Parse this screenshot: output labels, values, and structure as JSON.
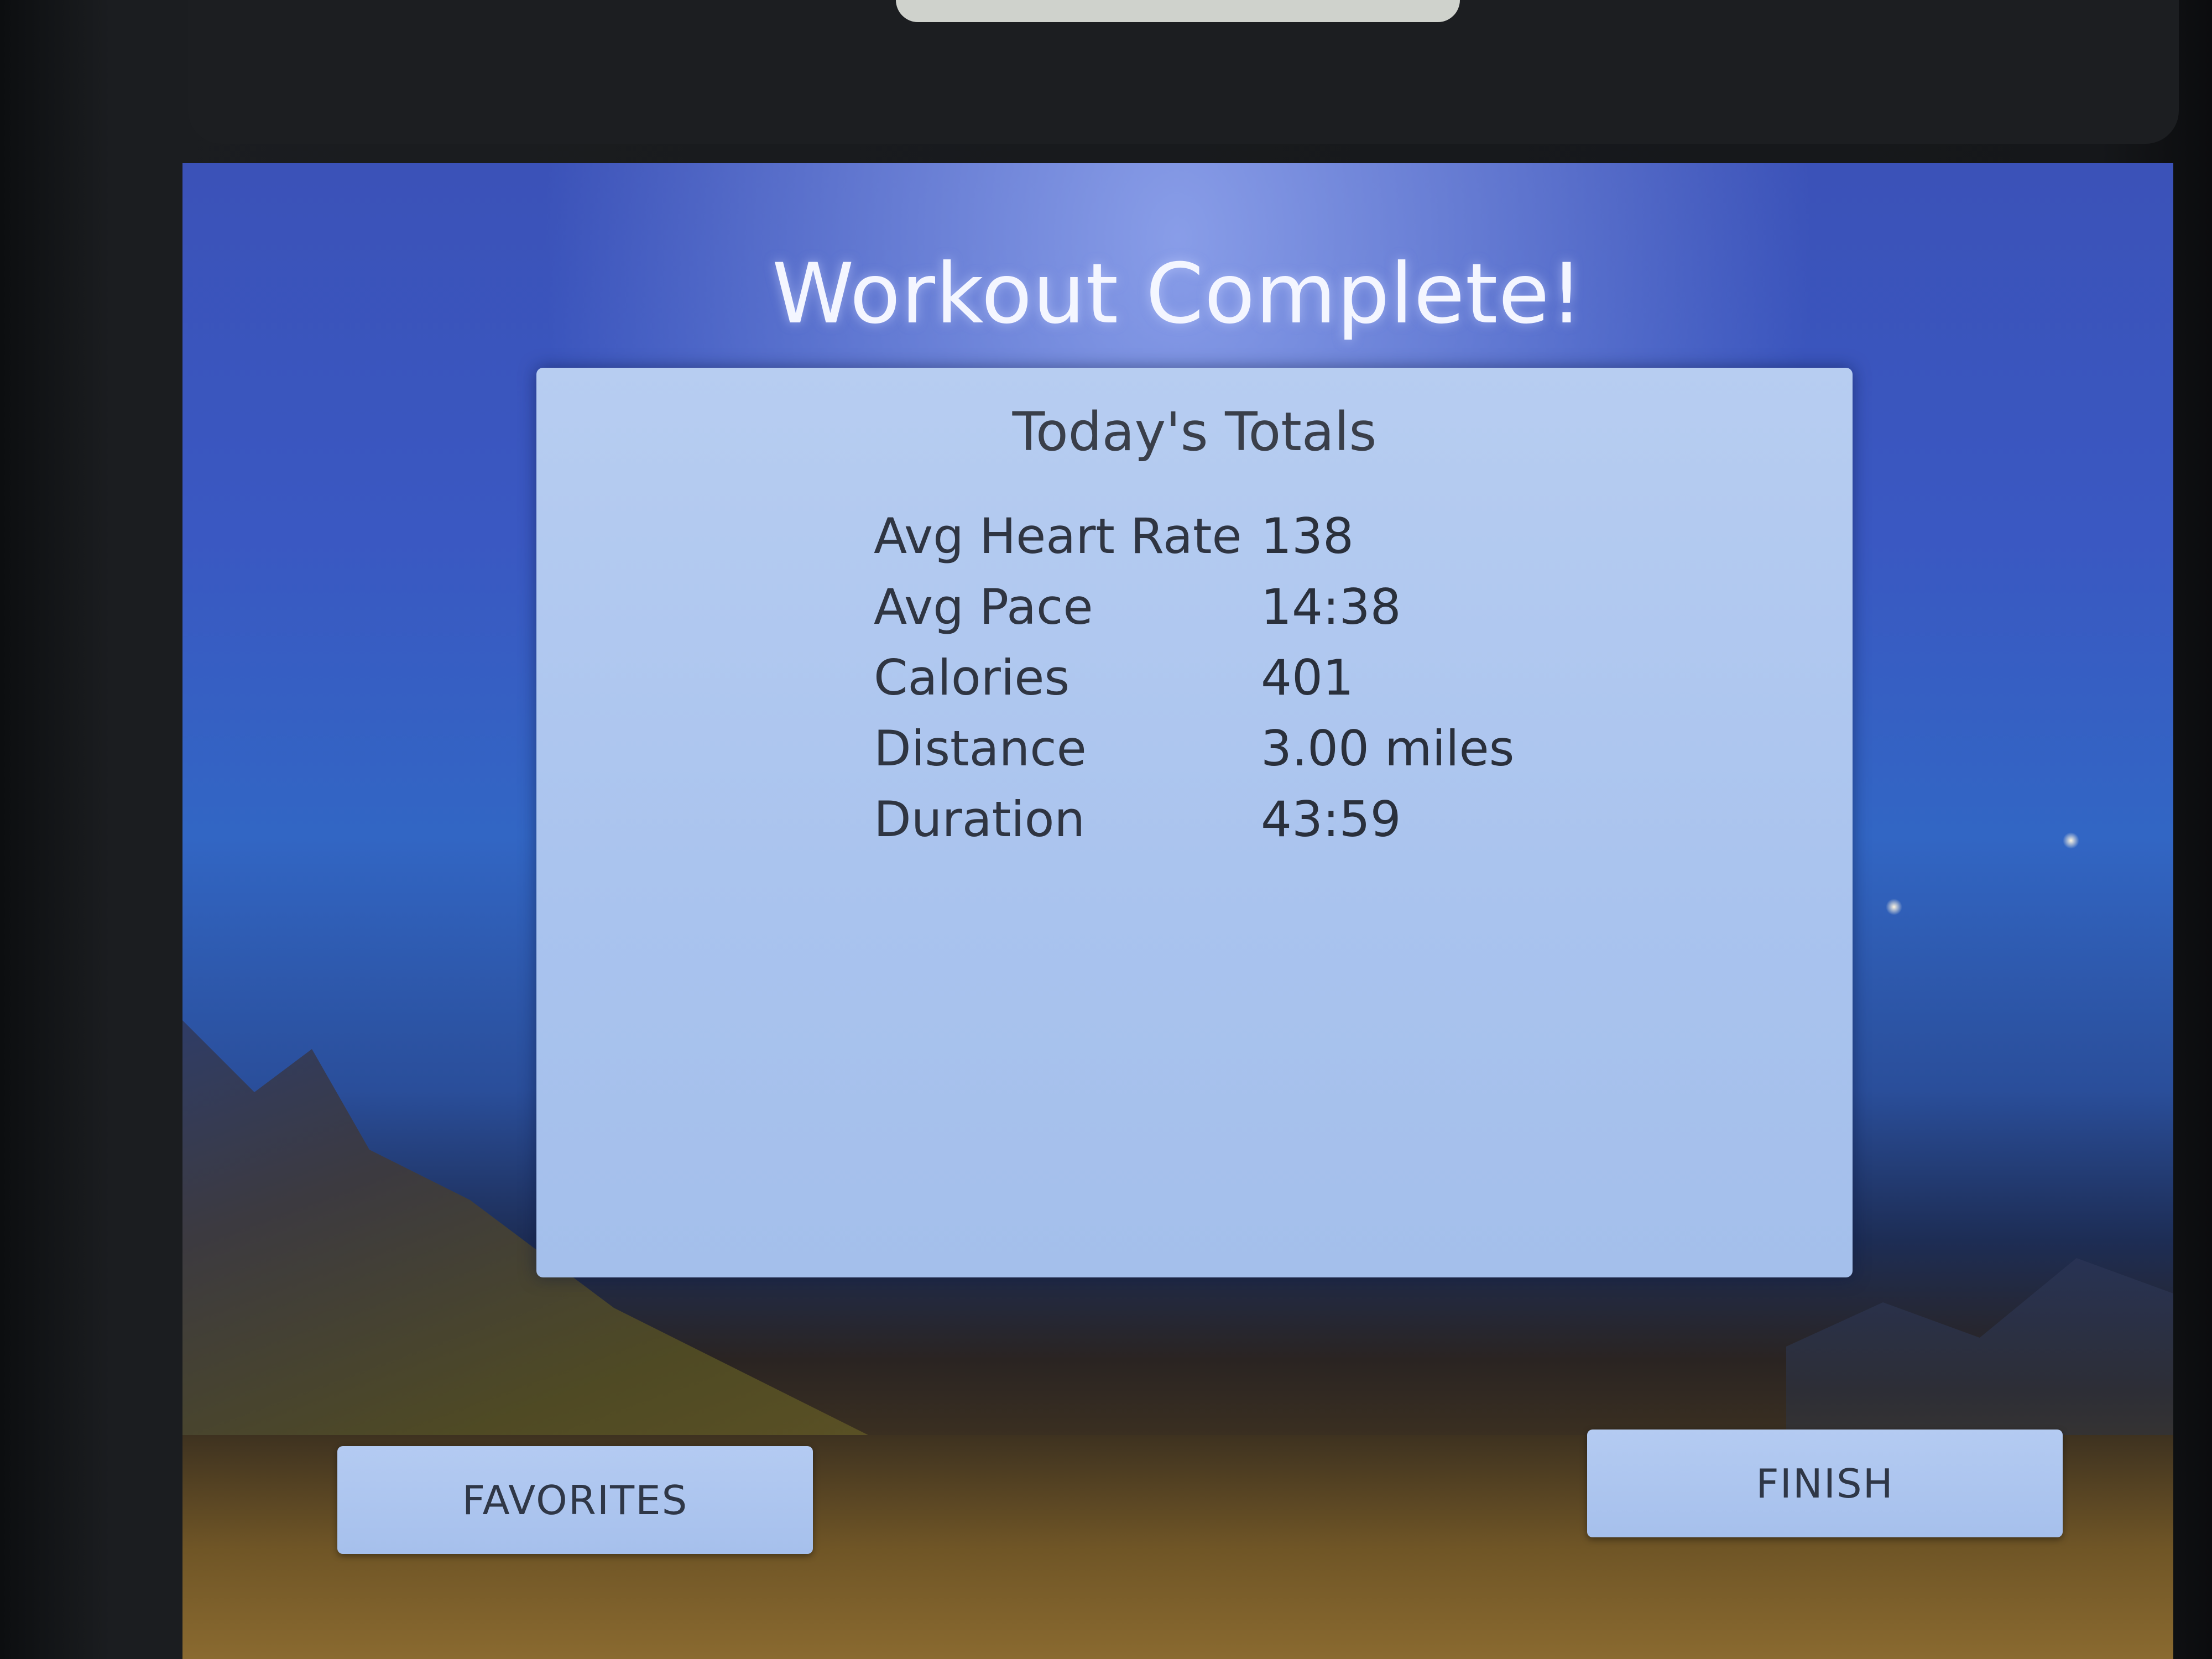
{
  "screen": {
    "title": "Workout Complete!"
  },
  "totals": {
    "heading": "Today's Totals",
    "rows": [
      {
        "label": "Avg Heart Rate",
        "value": "138"
      },
      {
        "label": "Avg Pace",
        "value": "14:38"
      },
      {
        "label": "Calories",
        "value": "401"
      },
      {
        "label": "Distance",
        "value": "3.00 miles"
      },
      {
        "label": "Duration",
        "value": "43:59"
      }
    ]
  },
  "buttons": {
    "favorites_label": "FAVORITES",
    "finish_label": "FINISH"
  },
  "colors": {
    "panel_background": "#aec6ee",
    "button_background": "#aec6ee",
    "text_dark": "#2f3542",
    "title_text": "#f4f6ff"
  }
}
